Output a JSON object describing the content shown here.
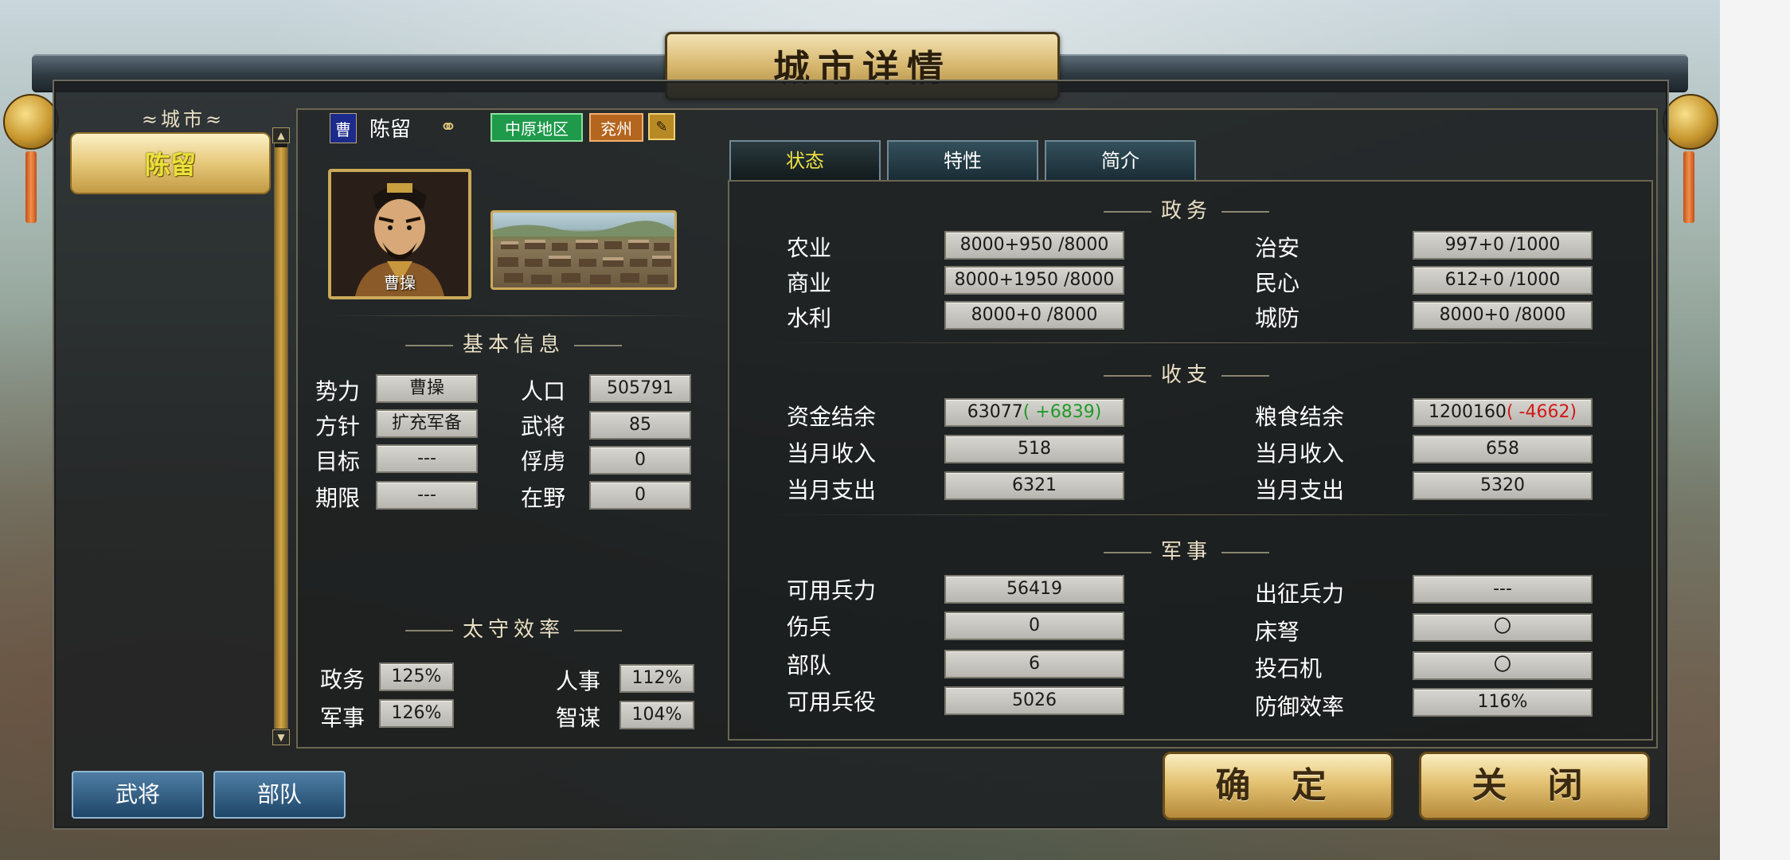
{
  "window": {
    "title": "城市详情"
  },
  "left_panel": {
    "header": "城市",
    "cities": [
      "陈留"
    ]
  },
  "breadcrumb": {
    "ruler_badge": "曹",
    "city": "陈留",
    "icon": "kinship-icon",
    "region": "中原地区",
    "province": "兖州",
    "tag_icon": "brush-icon"
  },
  "portrait": {
    "name": "曹操"
  },
  "basic_info": {
    "header": "基本信息",
    "rows": [
      {
        "label": "势力",
        "value": "曹操"
      },
      {
        "label": "方针",
        "value": "扩充军备"
      },
      {
        "label": "目标",
        "value": "---"
      },
      {
        "label": "期限",
        "value": "---"
      }
    ],
    "rows_right": [
      {
        "label": "人口",
        "value": "505791"
      },
      {
        "label": "武将",
        "value": "85"
      },
      {
        "label": "俘虏",
        "value": "0"
      },
      {
        "label": "在野",
        "value": "0"
      }
    ]
  },
  "efficiency": {
    "header": "太守效率",
    "items": [
      {
        "label": "政务",
        "value": "125%"
      },
      {
        "label": "人事",
        "value": "112%"
      },
      {
        "label": "军事",
        "value": "126%"
      },
      {
        "label": "智谋",
        "value": "104%"
      }
    ]
  },
  "tabs": [
    "状态",
    "特性",
    "简介"
  ],
  "politics": {
    "header": "政务",
    "left": [
      {
        "label": "农业",
        "value": "8000+950 /8000"
      },
      {
        "label": "商业",
        "value": "8000+1950 /8000"
      },
      {
        "label": "水利",
        "value": "8000+0 /8000"
      }
    ],
    "right": [
      {
        "label": "治安",
        "value": "997+0 /1000"
      },
      {
        "label": "民心",
        "value": "612+0 /1000"
      },
      {
        "label": "城防",
        "value": "8000+0 /8000"
      }
    ]
  },
  "finance": {
    "header": "收支",
    "funds_label": "资金结余",
    "funds_value": "63077",
    "funds_delta": "( +6839)",
    "food_label": "粮食结余",
    "food_value": "1200160",
    "food_delta": "( -4662)",
    "left": [
      {
        "label": "当月收入",
        "value": "518"
      },
      {
        "label": "当月支出",
        "value": "6321"
      }
    ],
    "right": [
      {
        "label": "当月收入",
        "value": "658"
      },
      {
        "label": "当月支出",
        "value": "5320"
      }
    ]
  },
  "military": {
    "header": "军事",
    "left": [
      {
        "label": "可用兵力",
        "value": "56419"
      },
      {
        "label": "伤兵",
        "value": "0"
      },
      {
        "label": "部队",
        "value": "6"
      },
      {
        "label": "可用兵役",
        "value": "5026"
      }
    ],
    "right": [
      {
        "label": "出征兵力",
        "value": "---"
      },
      {
        "label": "床弩",
        "value": "〇"
      },
      {
        "label": "投石机",
        "value": "〇"
      },
      {
        "label": "防御效率",
        "value": "116%"
      }
    ]
  },
  "bottom": {
    "generals_button": "武将",
    "troops_button": "部队",
    "confirm_button": "确 定",
    "close_button": "关 闭"
  },
  "colors": {
    "positive": "#1f9a2a",
    "negative": "#d01a1a",
    "selected_tab": "#f0e240",
    "city_label": "#e8e23a"
  }
}
